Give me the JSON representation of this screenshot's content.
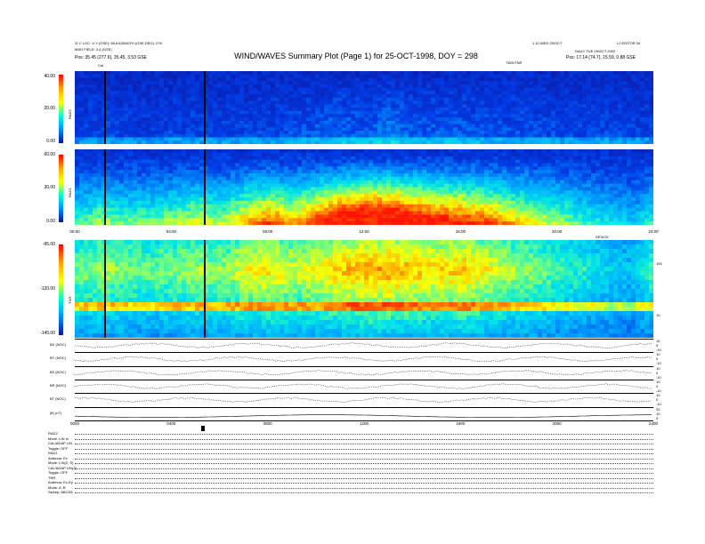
{
  "header": {
    "title": "WIND/WAVES Summary Plot (Page 1) for 25-OCT-1998, DOY = 298",
    "top_left_line1": "S/ C LOC: X-Y (GSE): 58.8  AZIMUTH (GSE DEG): 278",
    "top_left_line2": "MAG  FIELD: 3.4 (GSE)",
    "top_left_line3": "Pos:  35.45 (277.6), 35.45, 3.53 GSE",
    "top_right_line1": "1.10 WED 25/OCT",
    "top_right_line2": "L2 EDITOR 04",
    "top_right_line3": "DAILY  TUE 29/OCT 2002",
    "top_right_line4": "Pos:  17.14 (74.7), 15.59, 0.88 GSE",
    "mid_right_label": "TIDE/TNR",
    "cal_label": "Cal"
  },
  "panels": {
    "rad2": {
      "label": "RAD2",
      "ticks": [
        "40.00",
        "20.00",
        "0.00"
      ]
    },
    "rad1": {
      "label": "RAD1",
      "ticks": [
        "60.00",
        "30.00",
        "0.00"
      ]
    },
    "tnr": {
      "label": "TNR",
      "ticks": [
        "-95.00",
        "-120.00",
        "-145.00"
      ],
      "right_ticks": [
        "100",
        "10"
      ]
    }
  },
  "time_axis": [
    "00:00",
    "04:00",
    "08:00",
    "12:00",
    "16:00",
    "20:00",
    "24:00"
  ],
  "time_axis_bottom": [
    "0000",
    "0400",
    "0800",
    "1200",
    "1600",
    "2000",
    "2400"
  ],
  "traces": [
    {
      "label": "BX (NOC)",
      "right": [
        "10",
        "0",
        "-10"
      ]
    },
    {
      "label": "BY (NOC)",
      "right": [
        "10",
        "0",
        "-10"
      ]
    },
    {
      "label": "BZ (NOC)",
      "right": [
        "10",
        "0",
        "-10"
      ]
    },
    {
      "label": "BR (NOC)",
      "right": [
        "10",
        "0",
        "-10"
      ]
    },
    {
      "label": "BT (NOC)",
      "right": [
        "10",
        "0",
        "-10"
      ]
    },
    {
      "label": "|B| (nT)",
      "right": [
        "20",
        "10",
        "0"
      ]
    }
  ],
  "info": [
    "RAD2",
    "Mode:   LIN  In",
    "CAL/ADAP  LIN",
    "Toggle:    OFF",
    "RAD1",
    "Antenna:   Ex",
    "Mode:  LIN(Z, S)",
    "CAL/ADAP  LIN(Z)",
    "Toggle:    OFF",
    "TNR",
    "Antenna:  Ex-Ey",
    "Mode:    A, B",
    "Sweep: ABCDE"
  ],
  "chart_data": [
    {
      "type": "heatmap",
      "name": "RAD2",
      "ylabel": "RAD2",
      "ylim": [
        0,
        40
      ],
      "x": [
        "00:00",
        "04:00",
        "08:00",
        "12:00",
        "16:00",
        "20:00",
        "24:00"
      ],
      "intensity_by_hour": [
        0.15,
        0.2,
        0.18,
        0.15,
        0.2,
        0.2,
        0.18,
        0.2,
        0.2,
        0.25,
        0.3,
        0.35,
        0.3,
        0.45,
        0.3,
        0.3,
        0.3,
        0.25,
        0.25,
        0.25,
        0.2,
        0.2,
        0.2,
        0.2
      ]
    },
    {
      "type": "heatmap",
      "name": "RAD1",
      "ylabel": "RAD1",
      "ylim": [
        0,
        60
      ],
      "x": [
        "00:00",
        "04:00",
        "08:00",
        "12:00",
        "16:00",
        "20:00",
        "24:00"
      ],
      "intensity_by_hour": [
        0.35,
        0.45,
        0.4,
        0.4,
        0.45,
        0.5,
        0.45,
        0.6,
        0.7,
        0.6,
        0.75,
        0.9,
        0.95,
        0.95,
        0.85,
        0.8,
        0.75,
        0.7,
        0.6,
        0.5,
        0.45,
        0.35,
        0.3,
        0.25
      ]
    },
    {
      "type": "heatmap",
      "name": "TNR",
      "ylabel": "TNR",
      "ylim": [
        -145,
        -95
      ],
      "x": [
        "00:00",
        "04:00",
        "08:00",
        "12:00",
        "16:00",
        "20:00",
        "24:00"
      ],
      "intensity_by_hour": [
        0.5,
        0.6,
        0.55,
        0.5,
        0.55,
        0.6,
        0.55,
        0.7,
        0.75,
        0.65,
        0.7,
        0.8,
        0.85,
        0.85,
        0.8,
        0.75,
        0.8,
        0.7,
        0.6,
        0.55,
        0.45,
        0.4,
        0.3,
        0.25
      ]
    }
  ],
  "colors": {
    "low": "#0a1eb4",
    "mid": "#00c8ff",
    "high": "#ff1e00"
  }
}
